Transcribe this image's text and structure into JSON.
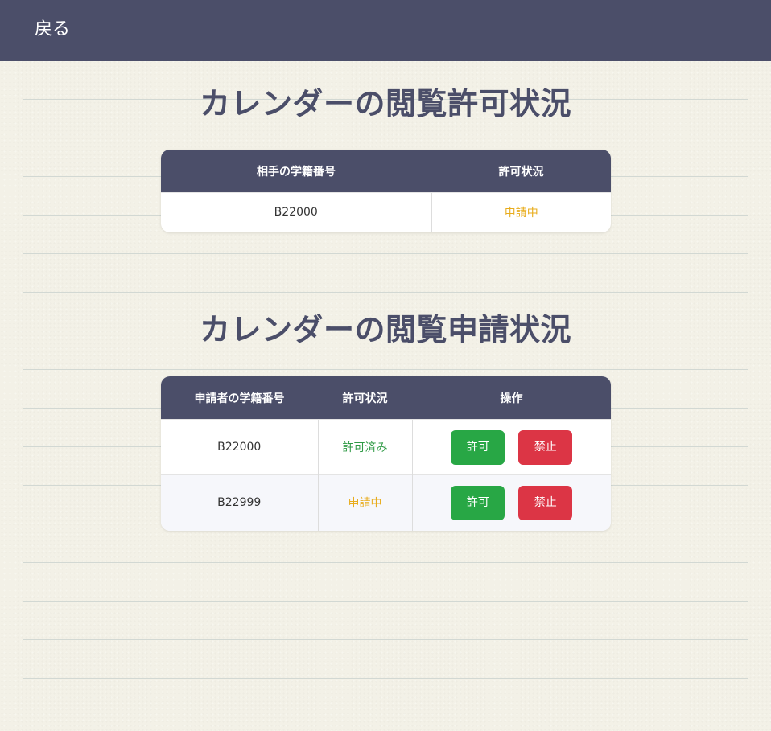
{
  "header": {
    "back_label": "戻る"
  },
  "permission_section": {
    "title": "カレンダーの閲覧許可状況",
    "columns": [
      "相手の学籍番号",
      "許可状況"
    ],
    "rows": [
      {
        "student_id": "B22000",
        "status": "申請中"
      }
    ]
  },
  "request_section": {
    "title": "カレンダーの閲覧申請状況",
    "columns": [
      "申請者の学籍番号",
      "許可状況",
      "操作"
    ],
    "rows": [
      {
        "student_id": "B22000",
        "status": "許可済み",
        "approve_label": "許可",
        "deny_label": "禁止"
      },
      {
        "student_id": "B22999",
        "status": "申請中",
        "approve_label": "許可",
        "deny_label": "禁止"
      }
    ]
  },
  "colors": {
    "header_bg": "#4b4e69",
    "pending": "#e8ac1c",
    "approved": "#2f9a45",
    "approve_button": "#28a745",
    "deny_button": "#dc3545"
  }
}
